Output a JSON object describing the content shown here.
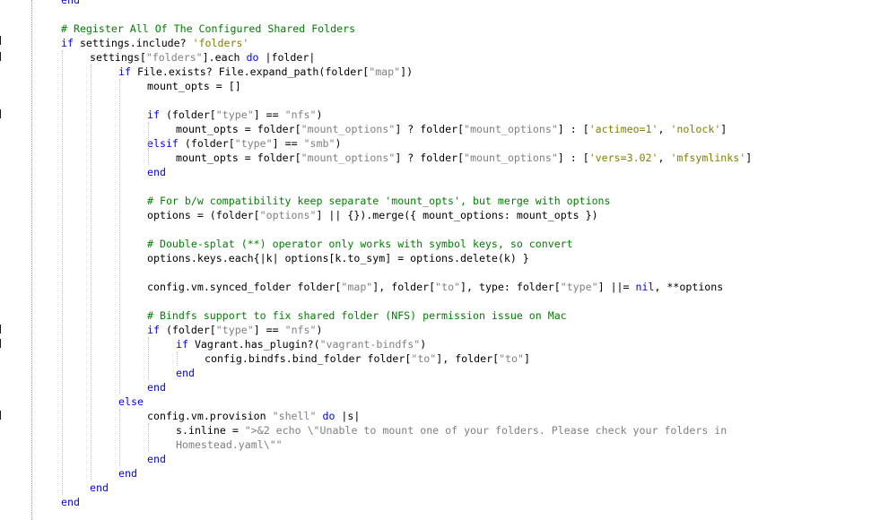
{
  "editor": {
    "language": "ruby",
    "colors": {
      "keyword": "#0000ff",
      "comment": "#008000",
      "single_quoted_string": "#808000",
      "double_quoted_string": "#808080",
      "plain": "#000000"
    },
    "lines": [
      {
        "indent": 1,
        "tokens": [
          {
            "t": "end",
            "c": "kw"
          }
        ]
      },
      {
        "indent": 1,
        "tokens": []
      },
      {
        "indent": 1,
        "tokens": [
          {
            "t": "# Register All Of The Configured Shared Folders",
            "c": "cm"
          }
        ]
      },
      {
        "indent": 1,
        "tokens": [
          {
            "t": "if",
            "c": "kw"
          },
          {
            "t": " settings.include? ",
            "c": "pl"
          },
          {
            "t": "'folders'",
            "c": "sq"
          }
        ]
      },
      {
        "indent": 2,
        "tokens": [
          {
            "t": "settings[",
            "c": "pl"
          },
          {
            "t": "\"folders\"",
            "c": "dq"
          },
          {
            "t": "].each ",
            "c": "pl"
          },
          {
            "t": "do",
            "c": "kw"
          },
          {
            "t": " |folder|",
            "c": "pl"
          }
        ]
      },
      {
        "indent": 3,
        "tokens": [
          {
            "t": "if",
            "c": "kw"
          },
          {
            "t": " File.exists? File.expand_path(folder[",
            "c": "pl"
          },
          {
            "t": "\"map\"",
            "c": "dq"
          },
          {
            "t": "])",
            "c": "pl"
          }
        ]
      },
      {
        "indent": 4,
        "tokens": [
          {
            "t": "mount_opts = []",
            "c": "pl"
          }
        ]
      },
      {
        "indent": 4,
        "tokens": []
      },
      {
        "indent": 4,
        "tokens": [
          {
            "t": "if",
            "c": "kw"
          },
          {
            "t": " (folder[",
            "c": "pl"
          },
          {
            "t": "\"type\"",
            "c": "dq"
          },
          {
            "t": "] == ",
            "c": "pl"
          },
          {
            "t": "\"nfs\"",
            "c": "dq"
          },
          {
            "t": ")",
            "c": "pl"
          }
        ]
      },
      {
        "indent": 5,
        "tokens": [
          {
            "t": "mount_opts = folder[",
            "c": "pl"
          },
          {
            "t": "\"mount_options\"",
            "c": "dq"
          },
          {
            "t": "] ? folder[",
            "c": "pl"
          },
          {
            "t": "\"mount_options\"",
            "c": "dq"
          },
          {
            "t": "] : [",
            "c": "pl"
          },
          {
            "t": "'actimeo=1'",
            "c": "sq"
          },
          {
            "t": ", ",
            "c": "pl"
          },
          {
            "t": "'nolock'",
            "c": "sq"
          },
          {
            "t": "]",
            "c": "pl"
          }
        ]
      },
      {
        "indent": 4,
        "tokens": [
          {
            "t": "elsif",
            "c": "kw"
          },
          {
            "t": " (folder[",
            "c": "pl"
          },
          {
            "t": "\"type\"",
            "c": "dq"
          },
          {
            "t": "] == ",
            "c": "pl"
          },
          {
            "t": "\"smb\"",
            "c": "dq"
          },
          {
            "t": ")",
            "c": "pl"
          }
        ]
      },
      {
        "indent": 5,
        "tokens": [
          {
            "t": "mount_opts = folder[",
            "c": "pl"
          },
          {
            "t": "\"mount_options\"",
            "c": "dq"
          },
          {
            "t": "] ? folder[",
            "c": "pl"
          },
          {
            "t": "\"mount_options\"",
            "c": "dq"
          },
          {
            "t": "] : [",
            "c": "pl"
          },
          {
            "t": "'vers=3.02'",
            "c": "sq"
          },
          {
            "t": ", ",
            "c": "pl"
          },
          {
            "t": "'mfsymlinks'",
            "c": "sq"
          },
          {
            "t": "]",
            "c": "pl"
          }
        ]
      },
      {
        "indent": 4,
        "tokens": [
          {
            "t": "end",
            "c": "kw"
          }
        ]
      },
      {
        "indent": 4,
        "tokens": []
      },
      {
        "indent": 4,
        "tokens": [
          {
            "t": "# For b/w compatibility keep separate 'mount_opts', but merge with options",
            "c": "cm"
          }
        ]
      },
      {
        "indent": 4,
        "tokens": [
          {
            "t": "options = (folder[",
            "c": "pl"
          },
          {
            "t": "\"options\"",
            "c": "dq"
          },
          {
            "t": "] || {}).merge({ mount_options: mount_opts })",
            "c": "pl"
          }
        ]
      },
      {
        "indent": 4,
        "tokens": []
      },
      {
        "indent": 4,
        "tokens": [
          {
            "t": "# Double-splat (**) operator only works with symbol keys, so convert",
            "c": "cm"
          }
        ]
      },
      {
        "indent": 4,
        "tokens": [
          {
            "t": "options.keys.each{|k| options[k.to_sym] = options.delete(k) }",
            "c": "pl"
          }
        ]
      },
      {
        "indent": 4,
        "tokens": []
      },
      {
        "indent": 4,
        "tokens": [
          {
            "t": "config.vm.synced_folder folder[",
            "c": "pl"
          },
          {
            "t": "\"map\"",
            "c": "dq"
          },
          {
            "t": "], folder[",
            "c": "pl"
          },
          {
            "t": "\"to\"",
            "c": "dq"
          },
          {
            "t": "], type: folder[",
            "c": "pl"
          },
          {
            "t": "\"type\"",
            "c": "dq"
          },
          {
            "t": "] ||= ",
            "c": "pl"
          },
          {
            "t": "nil",
            "c": "kw"
          },
          {
            "t": ", **options",
            "c": "pl"
          }
        ]
      },
      {
        "indent": 4,
        "tokens": []
      },
      {
        "indent": 4,
        "tokens": [
          {
            "t": "# Bindfs support to fix shared folder (NFS) permission issue on Mac",
            "c": "cm"
          }
        ]
      },
      {
        "indent": 4,
        "tokens": [
          {
            "t": "if",
            "c": "kw"
          },
          {
            "t": " (folder[",
            "c": "pl"
          },
          {
            "t": "\"type\"",
            "c": "dq"
          },
          {
            "t": "] == ",
            "c": "pl"
          },
          {
            "t": "\"nfs\"",
            "c": "dq"
          },
          {
            "t": ")",
            "c": "pl"
          }
        ]
      },
      {
        "indent": 5,
        "tokens": [
          {
            "t": "if",
            "c": "kw"
          },
          {
            "t": " Vagrant.has_plugin?(",
            "c": "pl"
          },
          {
            "t": "\"vagrant-bindfs\"",
            "c": "dq"
          },
          {
            "t": ")",
            "c": "pl"
          }
        ]
      },
      {
        "indent": 6,
        "tokens": [
          {
            "t": "config.bindfs.bind_folder folder[",
            "c": "pl"
          },
          {
            "t": "\"to\"",
            "c": "dq"
          },
          {
            "t": "], folder[",
            "c": "pl"
          },
          {
            "t": "\"to\"",
            "c": "dq"
          },
          {
            "t": "]",
            "c": "pl"
          }
        ]
      },
      {
        "indent": 5,
        "tokens": [
          {
            "t": "end",
            "c": "kw"
          }
        ]
      },
      {
        "indent": 4,
        "tokens": [
          {
            "t": "end",
            "c": "kw"
          }
        ]
      },
      {
        "indent": 3,
        "tokens": [
          {
            "t": "else",
            "c": "kw"
          }
        ]
      },
      {
        "indent": 4,
        "tokens": [
          {
            "t": "config.vm.provision ",
            "c": "pl"
          },
          {
            "t": "\"shell\"",
            "c": "dq"
          },
          {
            "t": " ",
            "c": "pl"
          },
          {
            "t": "do",
            "c": "kw"
          },
          {
            "t": " |s|",
            "c": "pl"
          }
        ]
      },
      {
        "indent": 5,
        "tokens": [
          {
            "t": "s.inline = ",
            "c": "pl"
          },
          {
            "t": "\">&2 echo \\\"Unable to mount one of your folders. Please check your folders in",
            "c": "dq"
          }
        ]
      },
      {
        "indent": 5,
        "tokens": [
          {
            "t": "Homestead.yaml\\\"\"",
            "c": "dq"
          }
        ]
      },
      {
        "indent": 4,
        "tokens": [
          {
            "t": "end",
            "c": "kw"
          }
        ]
      },
      {
        "indent": 3,
        "tokens": [
          {
            "t": "end",
            "c": "kw"
          }
        ]
      },
      {
        "indent": 2,
        "tokens": [
          {
            "t": "end",
            "c": "kw"
          }
        ]
      },
      {
        "indent": 1,
        "tokens": [
          {
            "t": "end",
            "c": "kw"
          }
        ]
      }
    ]
  }
}
